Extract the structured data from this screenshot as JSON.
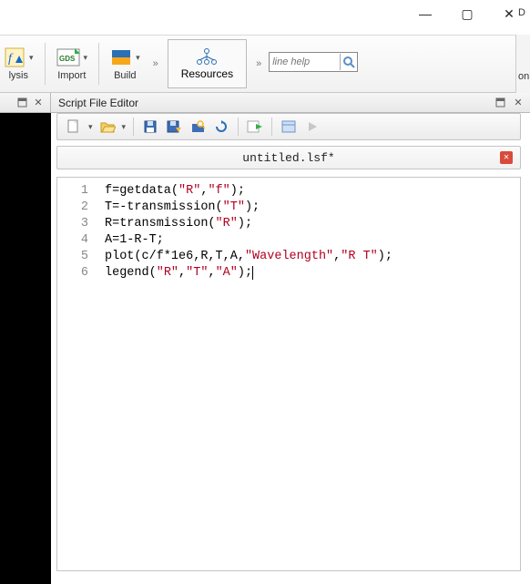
{
  "window": {
    "min": "—",
    "max": "▢",
    "close": "✕"
  },
  "right_edge_label": "D",
  "right_edge_label2": "on",
  "ribbon": {
    "analysis": "lysis",
    "import": "Import",
    "build": "Build",
    "resources": "Resources",
    "chevron": "»",
    "search_placeholder": "line help"
  },
  "pin_icon": "◧",
  "close_icon": "✕",
  "editor": {
    "title": "Script File Editor",
    "filename": "untitled.lsf*",
    "gutter": [
      "1",
      "2",
      "3",
      "4",
      "5",
      "6"
    ],
    "code": {
      "l1a": "f=getdata(",
      "l1s1": "\"R\"",
      "l1b": ",",
      "l1s2": "\"f\"",
      "l1c": ");",
      "l2a": "T=-transmission(",
      "l2s1": "\"T\"",
      "l2b": ");",
      "l3a": "R=transmission(",
      "l3s1": "\"R\"",
      "l3b": ");",
      "l4": "A=1-R-T;",
      "l5a": "plot(c/f*1e6,R,T,A,",
      "l5s1": "\"Wavelength\"",
      "l5b": ",",
      "l5s2": "\"R T\"",
      "l5c": ");",
      "l6a": "legend(",
      "l6s1": "\"R\"",
      "l6b": ",",
      "l6s2": "\"T\"",
      "l6c": ",",
      "l6s3": "\"A\"",
      "l6d": ");"
    }
  }
}
